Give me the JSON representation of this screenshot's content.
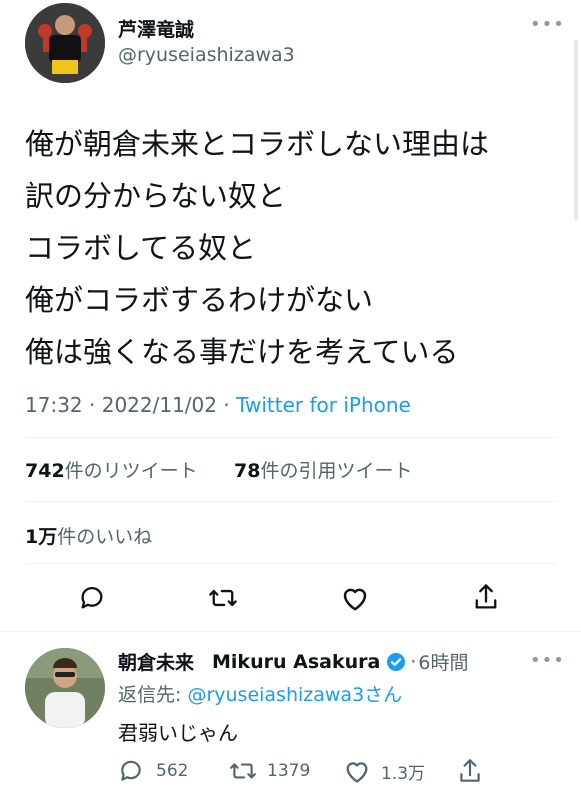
{
  "tweet": {
    "author": {
      "display_name": "芦澤竜誠",
      "handle": "@ryuseiashizawa3",
      "avatar_icon": "fighter-avatar"
    },
    "text_lines": [
      "俺が朝倉未来とコラボしない理由は",
      "訳の分からない奴と",
      "コラボしてる奴と",
      "俺がコラボするわけがない",
      "俺は強くなる事だけを考えている"
    ],
    "meta": {
      "time": "17:32",
      "sep1": "·",
      "date": "2022/11/02",
      "sep2": "·",
      "source": "Twitter for iPhone"
    },
    "stats": {
      "retweets": "742",
      "retweets_label": "件のリツイート",
      "quotes": "78",
      "quotes_label": "件の引用ツイート",
      "likes": "1万",
      "likes_label": "件のいいね"
    },
    "actions": [
      "reply-icon",
      "retweet-icon",
      "like-icon",
      "share-icon"
    ]
  },
  "reply": {
    "author": {
      "display_name": "朝倉未来",
      "display_name_en": "Mikuru Asakura",
      "verified_icon": "verified-badge-icon",
      "sep": "·",
      "time": "6時間"
    },
    "replying_to_label": "返信先:",
    "replying_to_handle": "@ryuseiashizawa3",
    "replying_to_suffix": "さん",
    "text": "君弱いじゃん",
    "counts": {
      "replies": "562",
      "retweets": "1379",
      "likes": "1.3万"
    }
  },
  "colors": {
    "accent": "#1d9bf0",
    "text": "#0f1419",
    "muted": "#536471",
    "divider": "#eff3f4"
  }
}
